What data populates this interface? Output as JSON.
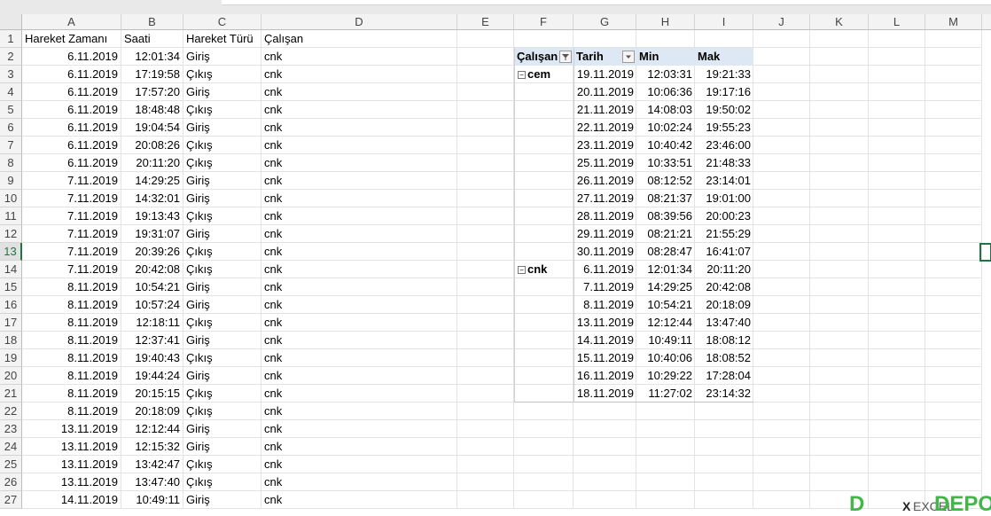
{
  "columns": [
    "A",
    "B",
    "C",
    "D",
    "E",
    "F",
    "G",
    "H",
    "I",
    "J",
    "K",
    "L",
    "M"
  ],
  "rows": [
    "1",
    "2",
    "3",
    "4",
    "5",
    "6",
    "7",
    "8",
    "9",
    "10",
    "11",
    "12",
    "13",
    "14",
    "15",
    "16",
    "17",
    "18",
    "19",
    "20",
    "21",
    "22",
    "23",
    "24",
    "25",
    "26",
    "27"
  ],
  "table": {
    "headers": [
      "Hareket Zamanı",
      "Saati",
      "Hareket Türü",
      "Çalışan"
    ],
    "data": [
      [
        "6.11.2019",
        "12:01:34",
        "Giriş",
        "cnk"
      ],
      [
        "6.11.2019",
        "17:19:58",
        "Çıkış",
        "cnk"
      ],
      [
        "6.11.2019",
        "17:57:20",
        "Giriş",
        "cnk"
      ],
      [
        "6.11.2019",
        "18:48:48",
        "Çıkış",
        "cnk"
      ],
      [
        "6.11.2019",
        "19:04:54",
        "Giriş",
        "cnk"
      ],
      [
        "6.11.2019",
        "20:08:26",
        "Çıkış",
        "cnk"
      ],
      [
        "6.11.2019",
        "20:11:20",
        "Çıkış",
        "cnk"
      ],
      [
        "7.11.2019",
        "14:29:25",
        "Giriş",
        "cnk"
      ],
      [
        "7.11.2019",
        "14:32:01",
        "Giriş",
        "cnk"
      ],
      [
        "7.11.2019",
        "19:13:43",
        "Çıkış",
        "cnk"
      ],
      [
        "7.11.2019",
        "19:31:07",
        "Giriş",
        "cnk"
      ],
      [
        "7.11.2019",
        "20:39:26",
        "Çıkış",
        "cnk"
      ],
      [
        "7.11.2019",
        "20:42:08",
        "Çıkış",
        "cnk"
      ],
      [
        "8.11.2019",
        "10:54:21",
        "Giriş",
        "cnk"
      ],
      [
        "8.11.2019",
        "10:57:24",
        "Giriş",
        "cnk"
      ],
      [
        "8.11.2019",
        "12:18:11",
        "Çıkış",
        "cnk"
      ],
      [
        "8.11.2019",
        "12:37:41",
        "Giriş",
        "cnk"
      ],
      [
        "8.11.2019",
        "19:40:43",
        "Çıkış",
        "cnk"
      ],
      [
        "8.11.2019",
        "19:44:24",
        "Giriş",
        "cnk"
      ],
      [
        "8.11.2019",
        "20:15:15",
        "Çıkış",
        "cnk"
      ],
      [
        "8.11.2019",
        "20:18:09",
        "Çıkış",
        "cnk"
      ],
      [
        "13.11.2019",
        "12:12:44",
        "Giriş",
        "cnk"
      ],
      [
        "13.11.2019",
        "12:15:32",
        "Giriş",
        "cnk"
      ],
      [
        "13.11.2019",
        "13:42:47",
        "Çıkış",
        "cnk"
      ],
      [
        "13.11.2019",
        "13:47:40",
        "Çıkış",
        "cnk"
      ],
      [
        "14.11.2019",
        "10:49:11",
        "Giriş",
        "cnk"
      ]
    ]
  },
  "pivot": {
    "headers": [
      "Çalışan",
      "Tarih",
      "Min",
      "Mak"
    ],
    "groups": [
      {
        "name": "cem",
        "rows": [
          [
            "19.11.2019",
            "12:03:31",
            "19:21:33"
          ],
          [
            "20.11.2019",
            "10:06:36",
            "19:17:16"
          ],
          [
            "21.11.2019",
            "14:08:03",
            "19:50:02"
          ],
          [
            "22.11.2019",
            "10:02:24",
            "19:55:23"
          ],
          [
            "23.11.2019",
            "10:40:42",
            "23:46:00"
          ],
          [
            "25.11.2019",
            "10:33:51",
            "21:48:33"
          ],
          [
            "26.11.2019",
            "08:12:52",
            "23:14:01"
          ],
          [
            "27.11.2019",
            "08:21:37",
            "19:01:00"
          ],
          [
            "28.11.2019",
            "08:39:56",
            "20:00:23"
          ],
          [
            "29.11.2019",
            "08:21:21",
            "21:55:29"
          ],
          [
            "30.11.2019",
            "08:28:47",
            "16:41:07"
          ]
        ]
      },
      {
        "name": "cnk",
        "rows": [
          [
            "6.11.2019",
            "12:01:34",
            "20:11:20"
          ],
          [
            "7.11.2019",
            "14:29:25",
            "20:42:08"
          ],
          [
            "8.11.2019",
            "10:54:21",
            "20:18:09"
          ],
          [
            "13.11.2019",
            "12:12:44",
            "13:47:40"
          ],
          [
            "14.11.2019",
            "10:49:11",
            "18:08:12"
          ],
          [
            "15.11.2019",
            "10:40:06",
            "18:08:52"
          ],
          [
            "16.11.2019",
            "10:29:22",
            "17:28:04"
          ],
          [
            "18.11.2019",
            "11:27:02",
            "23:14:32"
          ]
        ]
      }
    ]
  },
  "selected_row": "13",
  "logo": {
    "x": "X",
    "ex": "EXCEL",
    "depo": "DEPO"
  },
  "colors": {
    "accent": "#217346",
    "pivot_header": "#dde8f4",
    "logo_green": "#43b649"
  }
}
